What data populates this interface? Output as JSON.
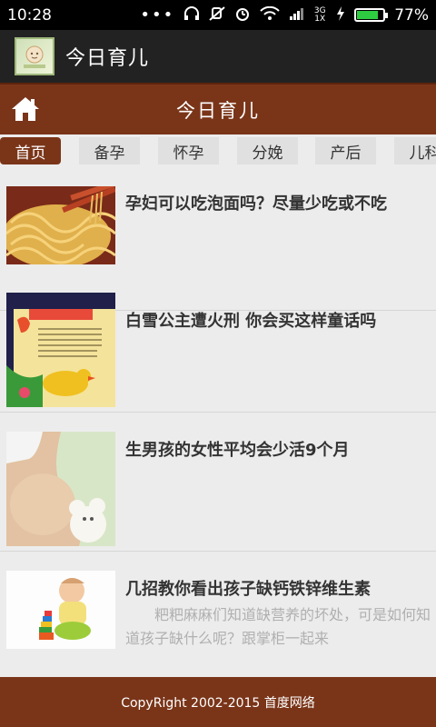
{
  "status_bar": {
    "time": "10:28",
    "network": "3G 1X",
    "battery_pct": "77%",
    "battery_level": 0.77
  },
  "app_bar": {
    "title": "今日育儿"
  },
  "header": {
    "title": "今日育儿"
  },
  "tabs": [
    {
      "label": "首页",
      "active": true
    },
    {
      "label": "备孕",
      "active": false
    },
    {
      "label": "怀孕",
      "active": false
    },
    {
      "label": "分娩",
      "active": false
    },
    {
      "label": "产后",
      "active": false
    },
    {
      "label": "儿科",
      "active": false
    }
  ],
  "articles": [
    {
      "title": "孕妇可以吃泡面吗？尽量少吃或不吃",
      "desc": ""
    },
    {
      "title": "白雪公主遭火刑 你会买这样童话吗",
      "desc": ""
    },
    {
      "title": "生男孩的女性平均会少活9个月",
      "desc": ""
    },
    {
      "title": "几招教你看出孩子缺钙铁锌维生素",
      "desc": "　　粑粑麻麻们知道缺营养的坏处，可是如何知道孩子缺什么呢？跟掌柜一起来"
    }
  ],
  "footer": {
    "copyright": "CopyRight 2002-2015 首度网络"
  },
  "colors": {
    "brand": "#7a3519",
    "app_bar": "#222222",
    "status_bar": "#000000"
  }
}
